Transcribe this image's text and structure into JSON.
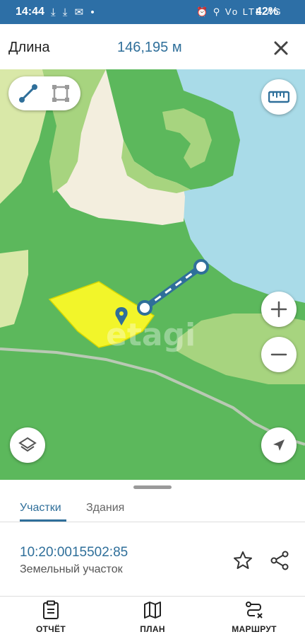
{
  "status_bar": {
    "time": "14:44",
    "left_icons": "⤓ ⤓ ✉ •",
    "right_icons": "⏰ ⚲ Vo LTE 4G",
    "battery": "42%"
  },
  "measure": {
    "label": "Длина",
    "value": "146,195 м"
  },
  "map": {
    "watermark": "etagi"
  },
  "tabs": [
    {
      "label": "Участки",
      "active": true
    },
    {
      "label": "Здания",
      "active": false
    }
  ],
  "parcel": {
    "number": "10:20:0015502:85",
    "type": "Земельный участок"
  },
  "bottom_nav": [
    {
      "label": "ОТЧЁТ",
      "icon": "report-icon"
    },
    {
      "label": "ПЛАН",
      "icon": "map-icon"
    },
    {
      "label": "МАРШРУТ",
      "icon": "route-icon"
    }
  ],
  "colors": {
    "accent": "#2f6f9a",
    "forest": "#5cb85c",
    "light_green": "#a7d47f",
    "sand": "#f3eede",
    "water": "#a9dbe8",
    "parcel": "#f2f52a"
  }
}
